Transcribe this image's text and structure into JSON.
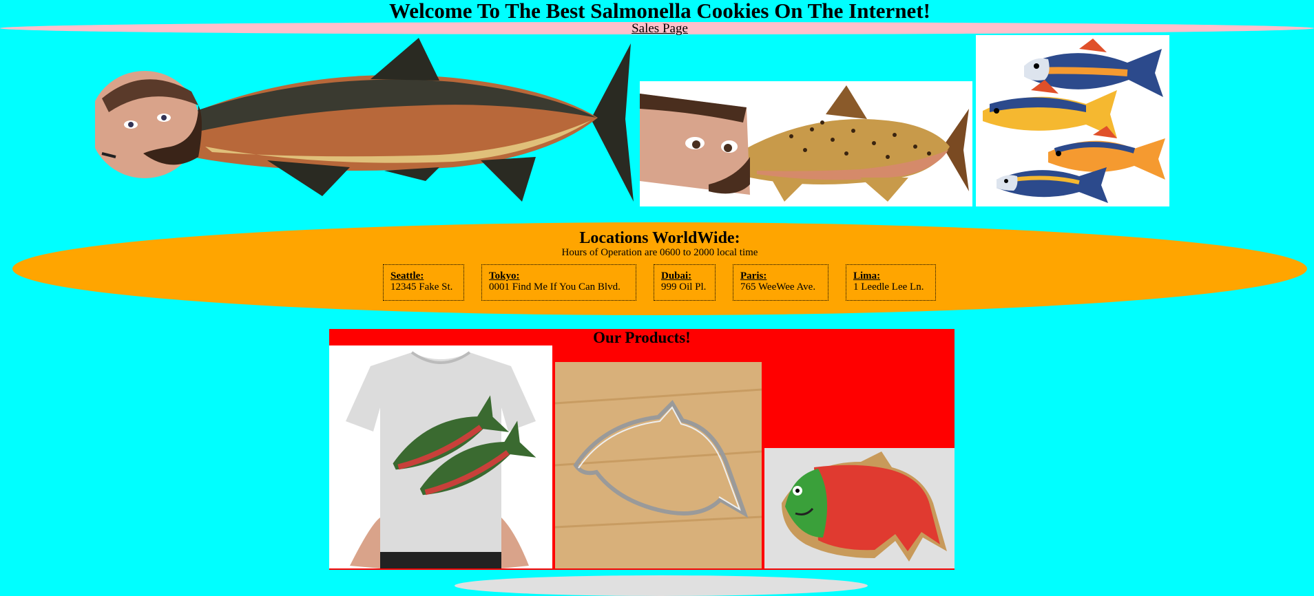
{
  "header": {
    "title": "Welcome To The Best Salmonella Cookies On The Internet!",
    "nav_link": "Sales Page"
  },
  "colors": {
    "page_background": "#00ffff",
    "nav_background": "#ffc0cb",
    "locations_background": "#ffa500",
    "products_background": "#ff0000"
  },
  "banner_images": [
    {
      "icon": "man-headed-salmon-image"
    },
    {
      "icon": "man-headed-trout-image"
    },
    {
      "icon": "cartoon-fish-group-image"
    }
  ],
  "locations": {
    "title": "Locations WorldWide:",
    "hours": "Hours of Operation are 0600 to 2000 local time",
    "items": [
      {
        "city": "Seattle:",
        "address": "12345 Fake St."
      },
      {
        "city": "Tokyo:",
        "address": "0001 Find Me If You Can Blvd."
      },
      {
        "city": "Dubai:",
        "address": "999 Oil Pl."
      },
      {
        "city": "Paris:",
        "address": "765 WeeWee Ave."
      },
      {
        "city": "Lima:",
        "address": "1 Leedle Lee Ln."
      }
    ]
  },
  "products": {
    "title": "Our Products!",
    "items": [
      {
        "icon": "salmon-tshirt-image"
      },
      {
        "icon": "fish-cookie-cutter-image"
      },
      {
        "icon": "salmon-cookie-image"
      }
    ]
  }
}
